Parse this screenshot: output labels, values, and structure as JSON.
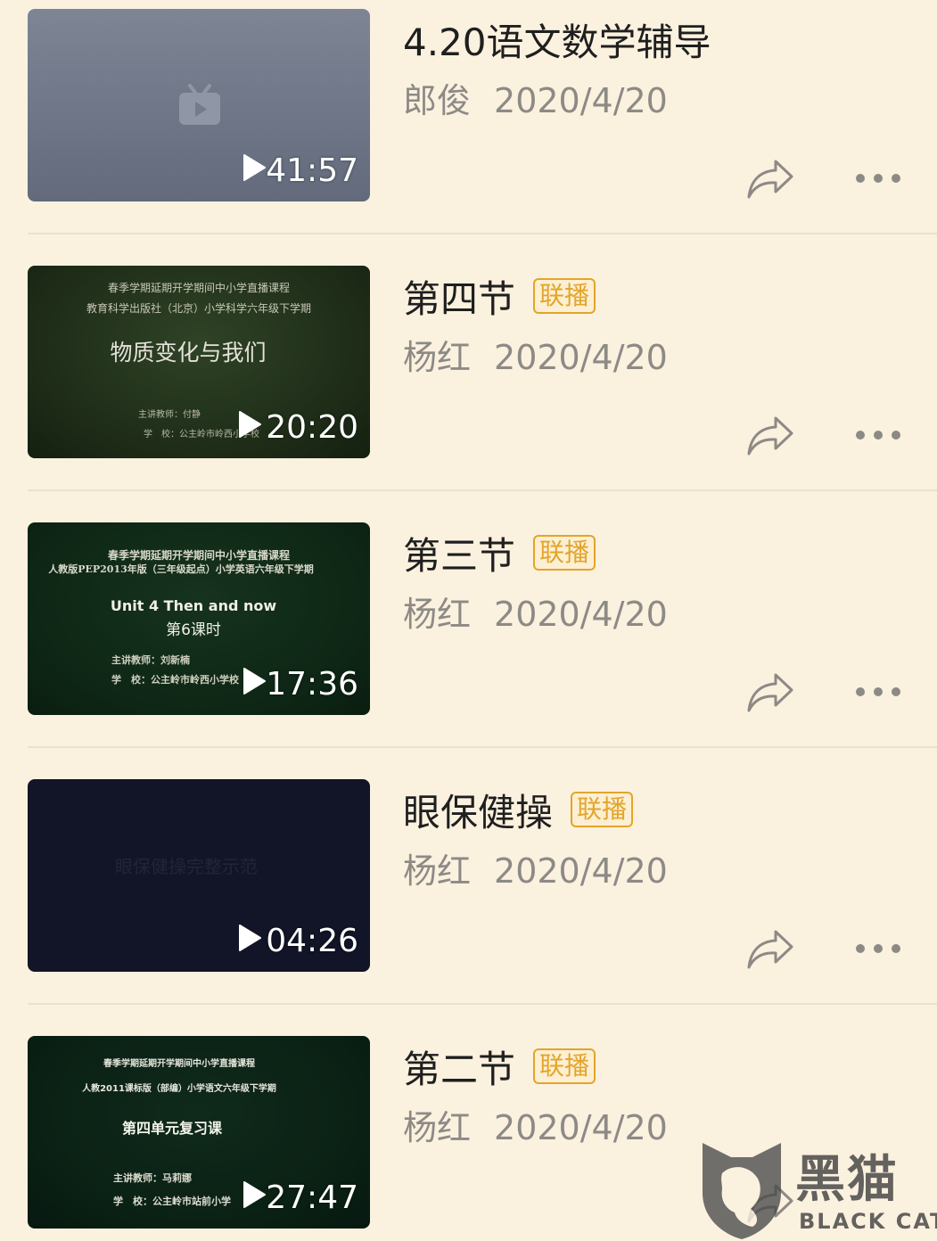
{
  "videos": [
    {
      "title": "4.20语文数学辅导",
      "badge": "",
      "author": "郎俊",
      "date": "2020/4/20",
      "duration": "41:57",
      "thumb": {
        "lines": []
      }
    },
    {
      "title": "第四节",
      "badge": "联播",
      "author": "杨红",
      "date": "2020/4/20",
      "duration": "20:20",
      "thumb": {
        "lines": [
          "春季学期延期开学期间中小学直播课程",
          "教育科学出版社（北京）小学科学六年级下学期",
          "物质变化与我们",
          "主讲教师：付静",
          "学　校：公主岭市岭西小学校"
        ]
      }
    },
    {
      "title": "第三节",
      "badge": "联播",
      "author": "杨红",
      "date": "2020/4/20",
      "duration": "17:36",
      "thumb": {
        "lines": [
          "春季学期延期开学期间中小学直播课程",
          "人教版PEP2013年版（三年级起点）小学英语六年级下学期",
          "Unit 4 Then and now",
          "第6课时",
          "主讲教师：刘新楠",
          "学　校：公主岭市岭西小学校"
        ]
      }
    },
    {
      "title": "眼保健操",
      "badge": "联播",
      "author": "杨红",
      "date": "2020/4/20",
      "duration": "04:26",
      "thumb": {
        "lines": [
          "眼保健操完整示范"
        ]
      }
    },
    {
      "title": "第二节",
      "badge": "联播",
      "author": "杨红",
      "date": "2020/4/20",
      "duration": "27:47",
      "thumb": {
        "lines": [
          "春季学期延期开学期间中小学直播课程",
          "人教2011课标版（部编）小学语文六年级下学期",
          "第四单元复习课",
          "主讲教师：马莉娜",
          "学　校：公主岭市站前小学"
        ]
      }
    }
  ],
  "watermark": {
    "cn": "黑猫",
    "en": "BLACK CAT"
  },
  "icons": [
    "tv-icon",
    "play-icon",
    "share-icon",
    "more-icon",
    "cat-logo-icon"
  ],
  "colors": {
    "background": "#fbf1df",
    "badge": "#e3a52a",
    "meta": "#8d8a86",
    "title": "#1f1f1f"
  }
}
